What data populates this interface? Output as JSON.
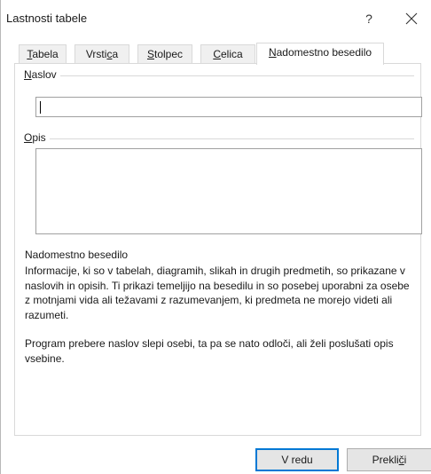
{
  "window": {
    "title": "Lastnosti tabele",
    "help_label": "?",
    "close_icon": "close-icon"
  },
  "tabs": [
    {
      "pre": "",
      "mn": "T",
      "post": "abela",
      "active": false
    },
    {
      "pre": "Vrsti",
      "mn": "c",
      "post": "a",
      "active": false
    },
    {
      "pre": "",
      "mn": "S",
      "post": "tolpec",
      "active": false
    },
    {
      "pre": "",
      "mn": "C",
      "post": "elica",
      "active": false
    },
    {
      "pre": "",
      "mn": "N",
      "post": "adomestno besedilo",
      "active": true
    }
  ],
  "alt_text": {
    "title_label_mn": "N",
    "title_label_rest": "aslov",
    "title_value": "",
    "description_label_mn": "O",
    "description_label_rest": "pis",
    "description_value": "",
    "help_heading": "Nadomestno besedilo",
    "help_paragraph_1": "Informacije, ki so v tabelah, diagramih, slikah in drugih predmetih, so prikazane v naslovih in opisih. Ti prikazi temeljijo na besedilu in so posebej uporabni za osebe z motnjami vida ali težavami z razumevanjem, ki predmeta ne morejo videti ali razumeti.",
    "help_paragraph_2": "Program prebere naslov slepi osebi, ta pa se nato odloči, ali želi poslušati opis vsebine."
  },
  "buttons": {
    "ok_label": "V redu",
    "cancel_pre": "Prekli",
    "cancel_mn": "č",
    "cancel_post": "i"
  }
}
